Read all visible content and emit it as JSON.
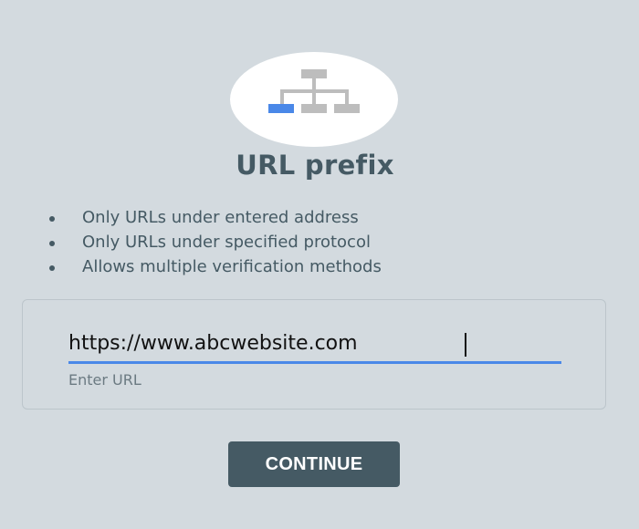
{
  "header": {
    "icon": "sitemap-icon",
    "title": "URL prefix"
  },
  "features": [
    "Only URLs under entered address",
    "Only URLs under specified protocol",
    "Allows multiple verification methods"
  ],
  "url_field": {
    "value": "https://www.abcwebsite.com",
    "helper_text": "Enter URL"
  },
  "continue_label": "CONTINUE",
  "colors": {
    "background": "#d3dadf",
    "accent": "#4a88e8",
    "button": "#455a64",
    "text": "#455a64",
    "icon_gray": "#bdbdbd"
  }
}
